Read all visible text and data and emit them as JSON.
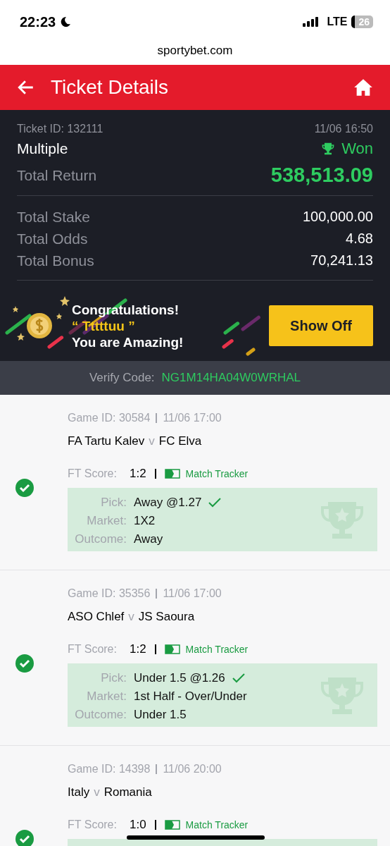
{
  "status_bar": {
    "time": "22:23",
    "network": "LTE",
    "battery": "26"
  },
  "browser": {
    "url": "sportybet.com"
  },
  "header": {
    "title": "Ticket Details"
  },
  "ticket": {
    "id": "Ticket ID: 132111",
    "datetime": "11/06 16:50",
    "type": "Multiple",
    "status": "Won",
    "return_label": "Total Return",
    "return_value": "538,513.09",
    "totals": [
      {
        "label": "Total Stake",
        "value": "100,000.00"
      },
      {
        "label": "Total Odds",
        "value": "4.68"
      },
      {
        "label": "Total Bonus",
        "value": "70,241.13"
      }
    ]
  },
  "banner": {
    "line1": "Congratulations!",
    "open_quote": "“",
    "name": "Tttttuu",
    "close_quote": "”",
    "line3": "You are Amazing!",
    "button": "Show Off"
  },
  "verify": {
    "label": "Verify Code:",
    "code": "NG1M14HA04W0WRHAL"
  },
  "games": [
    {
      "won": true,
      "game_id": "Game ID: 30584",
      "time": "11/06 17:00",
      "home": "FA Tartu Kalev",
      "versus": "v",
      "away": "FC Elva",
      "score_label": "FT Score:",
      "score": "1:2",
      "tracker": "Match Tracker",
      "pick_rows": [
        {
          "label": "Pick:",
          "value": "Away @1.27",
          "check": true
        },
        {
          "label": "Market:",
          "value": "1X2",
          "check": false
        },
        {
          "label": "Outcome:",
          "value": "Away",
          "check": false
        }
      ]
    },
    {
      "won": true,
      "game_id": "Game ID: 35356",
      "time": "11/06 17:00",
      "home": "ASO Chlef",
      "versus": "v",
      "away": "JS Saoura",
      "score_label": "FT Score:",
      "score": "1:2",
      "tracker": "Match Tracker",
      "pick_rows": [
        {
          "label": "Pick:",
          "value": "Under 1.5 @1.26",
          "check": true
        },
        {
          "label": "Market:",
          "value": "1st Half - Over/Under",
          "check": false
        },
        {
          "label": "Outcome:",
          "value": "Under 1.5",
          "check": false
        }
      ]
    },
    {
      "won": true,
      "game_id": "Game ID: 14398",
      "time": "11/06 20:00",
      "home": "Italy",
      "versus": "v",
      "away": "Romania",
      "score_label": "FT Score:",
      "score": "1:0",
      "tracker": "Match Tracker"
    }
  ]
}
